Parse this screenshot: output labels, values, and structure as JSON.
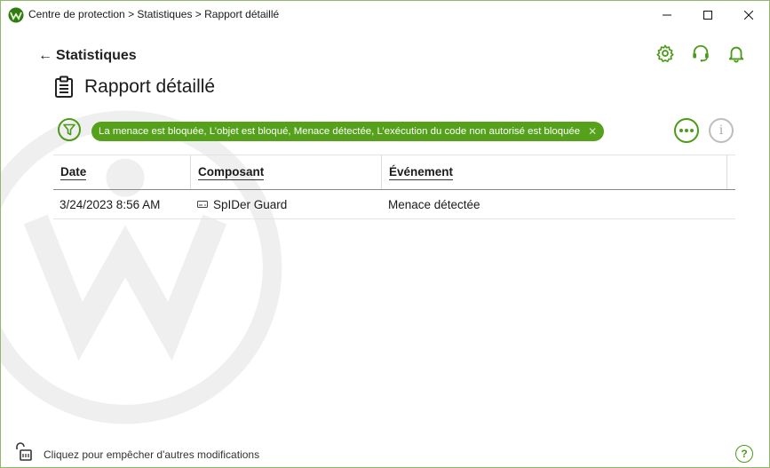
{
  "window": {
    "title": "Centre de protection > Statistiques > Rapport détaillé"
  },
  "nav": {
    "back_label": "Statistiques"
  },
  "page": {
    "title": "Rapport détaillé"
  },
  "filter": {
    "chip_label": "La menace est bloquée, L’objet est bloqué, Menace détectée, L’exécution du code non autorisé est bloquée"
  },
  "table": {
    "columns": [
      "Date",
      "Composant",
      "Événement"
    ],
    "rows": [
      {
        "date": "3/24/2023 8:56 AM",
        "component": "SpIDer Guard",
        "event": "Menace détectée"
      }
    ]
  },
  "footer": {
    "lock_text": "Cliquez pour empêcher d'autres modifications",
    "help_label": "?"
  },
  "colors": {
    "accent": "#4b9b18",
    "chip_bg": "#56a11b",
    "border": "#8fb86a"
  }
}
